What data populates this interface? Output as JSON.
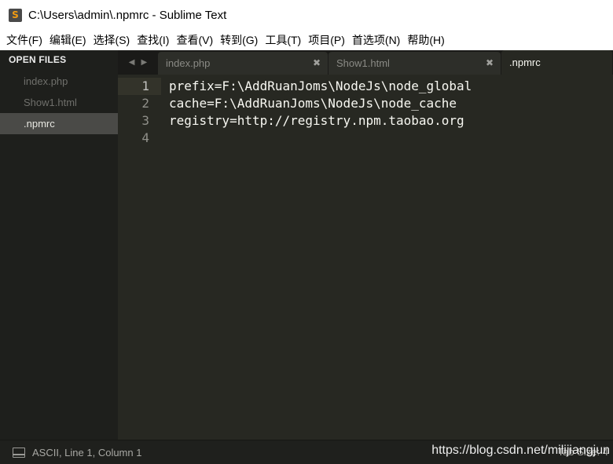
{
  "window": {
    "title": "C:\\Users\\admin\\.npmrc - Sublime Text",
    "icon_letter": "S"
  },
  "menu": [
    "文件(F)",
    "编辑(E)",
    "选择(S)",
    "查找(I)",
    "查看(V)",
    "转到(G)",
    "工具(T)",
    "项目(P)",
    "首选项(N)",
    "帮助(H)"
  ],
  "sidebar": {
    "header": "OPEN FILES",
    "files": [
      {
        "name": "index.php",
        "active": false
      },
      {
        "name": "Show1.html",
        "active": false
      },
      {
        "name": ".npmrc",
        "active": true
      }
    ]
  },
  "tabs": {
    "nav_left": "◀",
    "nav_right": "▶",
    "close_glyph": "✖",
    "items": [
      {
        "label": "index.php",
        "active": false
      },
      {
        "label": "Show1.html",
        "active": false
      },
      {
        "label": ".npmrc",
        "active": true
      }
    ]
  },
  "editor": {
    "current_line": 1,
    "lines": [
      {
        "number": "1",
        "text": "prefix=F:\\AddRuanJoms\\NodeJs\\node_global"
      },
      {
        "number": "2",
        "text": "cache=F:\\AddRuanJoms\\NodeJs\\node_cache"
      },
      {
        "number": "3",
        "text": "registry=http://registry.npm.taobao.org"
      },
      {
        "number": "4",
        "text": ""
      }
    ]
  },
  "status": {
    "left": "ASCII, Line 1, Column 1",
    "right": "Tab Size: 4",
    "watermark": "https://blog.csdn.net/milijiangjun"
  },
  "colors": {
    "editor_bg": "#272822",
    "sidebar_bg": "#1e1f1c",
    "text": "#f8f8f2",
    "line_number": "#90908a"
  }
}
